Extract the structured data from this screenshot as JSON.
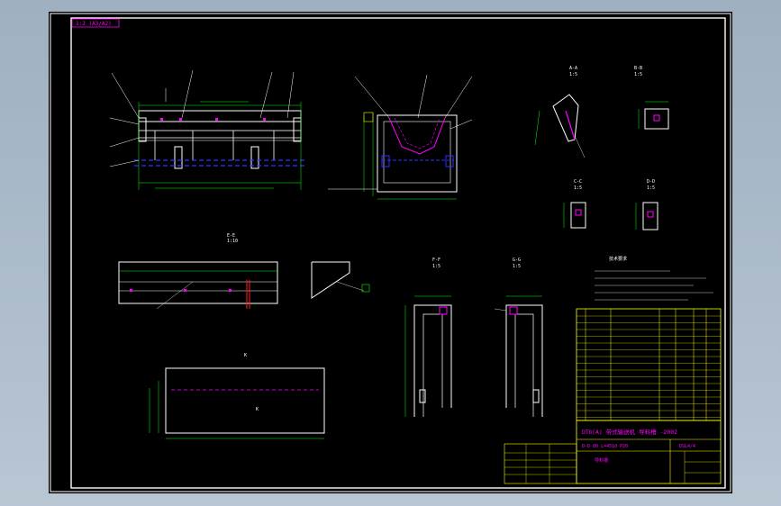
{
  "colors": {
    "viewport_bg": "#a8b8c8",
    "sheet_bg": "#000000",
    "frame": "#ffffff",
    "geometry": "#ffffff",
    "dimension": "#00ff00",
    "hidden_line": "#3030ff",
    "leader": "#ffffff",
    "annotation": "#ff00ff",
    "section_line": "#ff2020",
    "title_block": "#ffff00"
  },
  "drawing": {
    "corner_tag": "1:2 (A3/A2)",
    "title_block_main": "DTⅡ(A) 带式输送机 导料槽 -2002",
    "title_block_code": "D-D 80 L=4510 P20",
    "title_block_sheet": "DSL4/4",
    "title_block_label": "导料槽",
    "tech_requirements_heading": "技术要求"
  },
  "views": {
    "section_a_a": "A-A",
    "section_b_b": "B-B",
    "section_c_c": "C-C",
    "section_d_d": "D-D",
    "section_e_e": "E-E",
    "section_f_f": "F-F",
    "section_g_g": "G-G",
    "scale_1_5": "1:5",
    "scale_1_10": "1:10",
    "view_k": "K"
  },
  "icons": {
    "ucs": "ucs-icon"
  }
}
